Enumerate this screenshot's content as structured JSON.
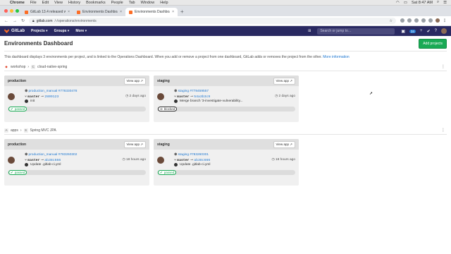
{
  "menubar": {
    "apple": "",
    "items": [
      "Chrome",
      "File",
      "Edit",
      "View",
      "History",
      "Bookmarks",
      "People",
      "Tab",
      "Window",
      "Help"
    ],
    "clock": "Sat 8:47 AM"
  },
  "tabs": [
    {
      "title": "GitLab 13.4 released with Vau",
      "active": false
    },
    {
      "title": "Environments Dashboard | GitL",
      "active": false
    },
    {
      "title": "Environments Dashboard · GitL",
      "active": true
    }
  ],
  "address": {
    "host": "gitlab.com",
    "path": "/-/operations/environments"
  },
  "gitlab_nav": {
    "brand": "GitLab",
    "items": [
      "Projects ▾",
      "Groups ▾",
      "More ▾"
    ],
    "search_placeholder": "Search or jump to…",
    "mr_count": "34"
  },
  "page": {
    "title": "Environments Dashboard",
    "add_button": "Add projects",
    "info": "This dashboard displays 3 environments per project, and is linked to the Operations Dashboard. When you add or remove a project from one dashboard, GitLab adds or removes the project from the other.",
    "more_info": "More information"
  },
  "projects": [
    {
      "group": "workshop",
      "group_initial": "",
      "name": "cloud-native-spring",
      "name_initial": "C",
      "environments": [
        {
          "name": "production",
          "view_app": "View app",
          "job": "production_manual #778330478",
          "branch": "master",
          "sha": "2809123",
          "commit": "init",
          "time": "2 days ago",
          "status": "passed"
        },
        {
          "name": "staging",
          "view_app": "View app",
          "job": "staging #778459557",
          "branch": "master",
          "sha": "54a3b3c9",
          "commit": "Merge branch '3-investigate-vulnerability...",
          "time": "2 days ago",
          "status": "blocked"
        }
      ]
    },
    {
      "group": "apps",
      "group_initial": "A",
      "name": "Spring MVC JPA",
      "name_initial": "S",
      "environments": [
        {
          "name": "production",
          "view_app": "View app",
          "job": "production_manual #783260302",
          "branch": "master",
          "sha": "ab38c666",
          "commit": "Update .gitlab-ci.yml",
          "time": "18 hours ago",
          "status": "passed"
        },
        {
          "name": "staging",
          "view_app": "View app",
          "job": "staging #783260301",
          "branch": "master",
          "sha": "ab38c666",
          "commit": "Update .gitlab-ci.yml",
          "time": "18 hours ago",
          "status": "passed"
        }
      ]
    }
  ],
  "colors": {
    "navbar": "#292961",
    "add_button": "#1aaa55",
    "link": "#1f78d1",
    "passed": "#1aaa55"
  }
}
